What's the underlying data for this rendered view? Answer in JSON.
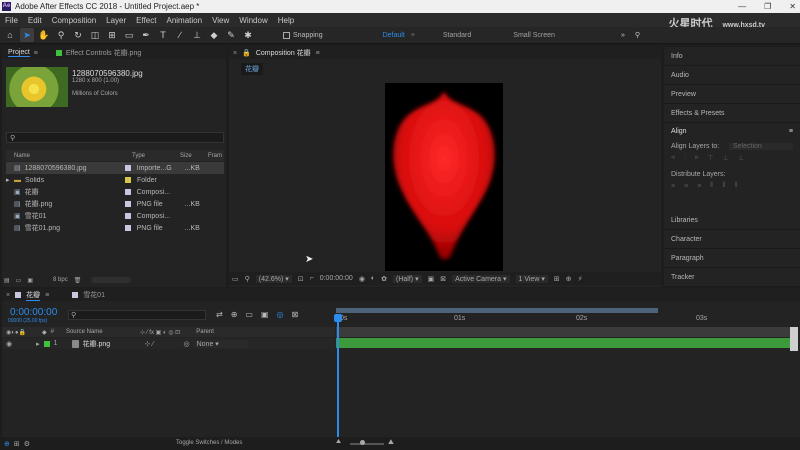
{
  "app": {
    "title": "Adobe After Effects CC 2018 - Untitled Project.aep *",
    "logo": "Ae",
    "win_controls": [
      "—",
      "❐",
      "✕"
    ]
  },
  "watermark": {
    "big": "火星时代",
    "small": "www.hxsd.tv"
  },
  "menu": [
    "File",
    "Edit",
    "Composition",
    "Layer",
    "Effect",
    "Animation",
    "View",
    "Window",
    "Help"
  ],
  "toolbar": {
    "snapping": "Snapping",
    "workspaces": [
      "Default",
      "Standard",
      "Small Screen"
    ],
    "active_workspace": "Default"
  },
  "project": {
    "tab_label": "Project",
    "effect_controls_label": "Effect Controls 花瓣.png",
    "thumb_name": "1288070596380.jpg",
    "thumb_dims": "1280 x 800 (1.00)",
    "thumb_colors": "Millions of Colors",
    "columns": [
      "Name",
      "Type",
      "Size",
      "Fram"
    ],
    "items": [
      {
        "name": "1288070596380.jpg",
        "type": "Importe...G",
        "size": "...KB",
        "color": "#c7c7e0",
        "icon": "image-file-icon"
      },
      {
        "name": "Solids",
        "type": "Folder",
        "size": "",
        "color": "#d8c64a",
        "icon": "folder-icon"
      },
      {
        "name": "花瓣",
        "type": "Composi...",
        "size": "",
        "color": "#c7c7e0",
        "icon": "composition-icon"
      },
      {
        "name": "花瓣.png",
        "type": "PNG file",
        "size": "...KB",
        "color": "#c7c7e0",
        "icon": "image-file-icon"
      },
      {
        "name": "雪花01",
        "type": "Composi...",
        "size": "",
        "color": "#c7c7e0",
        "icon": "composition-icon"
      },
      {
        "name": "雪花01.png",
        "type": "PNG file",
        "size": "...KB",
        "color": "#c7c7e0",
        "icon": "image-file-icon"
      }
    ],
    "bpc": "8 bpc"
  },
  "composition": {
    "header_label": "Composition 花瓣",
    "tab_label": "花瓣",
    "zoom": "(42.6%)",
    "timecode": "0:00:00:00",
    "resolution": "(Half)",
    "camera": "Active Camera",
    "views": "1 View"
  },
  "right_panel": {
    "items": [
      "Info",
      "Audio",
      "Preview",
      "Effects & Presets"
    ],
    "align_title": "Align",
    "align_layers_to": "Align Layers to:",
    "align_target": "Selection",
    "distribute_layers": "Distribute Layers:",
    "lower_items": [
      "Libraries",
      "Character",
      "Paragraph",
      "Tracker"
    ]
  },
  "timeline": {
    "tabs": [
      "花瓣",
      "雪花01"
    ],
    "timecode": "0:00:00:00",
    "fps_info": "00000 (25.00 fps)",
    "columns": {
      "source_name": "Source Name",
      "parent": "Parent"
    },
    "layer": {
      "index": "1",
      "name": "花瓣.png",
      "parent": "None"
    },
    "ruler": [
      "0s",
      "01s",
      "02s",
      "03s"
    ]
  },
  "status": {
    "toggle_label": "Toggle Switches / Modes"
  },
  "colors": {
    "accent": "#2d8ceb",
    "layer_bar": "#3c9a3c",
    "petal": "#e01010"
  }
}
